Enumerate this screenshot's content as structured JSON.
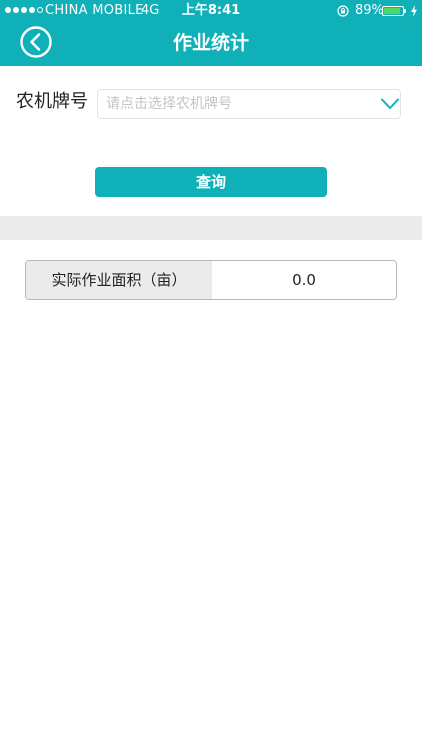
{
  "status_bar": {
    "carrier": "CHINA MOBILE",
    "network": "4G",
    "time": "上午8:41",
    "battery_percent": "89%",
    "battery_level": 0.89,
    "battery_color": "#4cd964",
    "icons": [
      "signal-dots",
      "orientation-lock-icon",
      "battery-icon",
      "charging-bolt-icon"
    ]
  },
  "header": {
    "title": "作业统计",
    "background_color": "#0fb0b8",
    "back_icon": "chevron-left-circle-icon"
  },
  "form": {
    "plate_label": "农机牌号",
    "plate_placeholder": "请点击选择农机牌号",
    "dropdown_icon": "chevron-down-icon",
    "query_button_label": "查询"
  },
  "result": {
    "label": "实际作业面积（亩）",
    "value": "0.0"
  }
}
